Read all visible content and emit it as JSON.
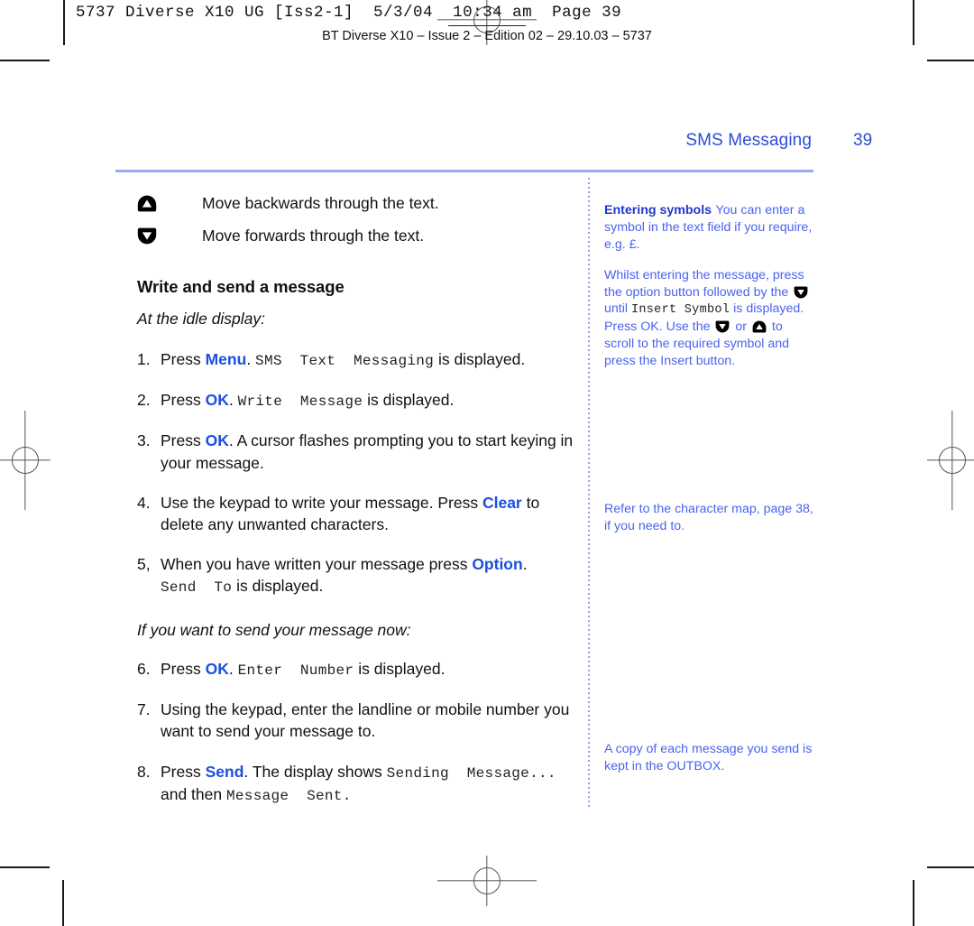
{
  "print_marks": {
    "slug_mono": "5737 Diverse X10 UG [Iss2-1]  5/3/04  10:34 am  Page 39",
    "slug_caption": "BT Diverse X10 – Issue 2 – Edition 02 – 29.10.03 – 5737"
  },
  "running_head": {
    "title": "SMS Messaging",
    "page_number": "39",
    "color": "#2b4cd8"
  },
  "main": {
    "key_rows": [
      {
        "icon": "up-arrow-key-icon",
        "label": "Move backwards through the text."
      },
      {
        "icon": "down-arrow-key-icon",
        "label": "Move forwards through the text."
      }
    ],
    "section_heading": "Write and send a message",
    "intro_italic": "At the idle display:",
    "steps": [
      {
        "num": "1.",
        "parts": [
          {
            "type": "text",
            "value": "Press "
          },
          {
            "type": "key",
            "value": "Menu"
          },
          {
            "type": "text",
            "value": ". "
          },
          {
            "type": "lcd",
            "value": "SMS  Text  Messaging"
          },
          {
            "type": "text",
            "value": " is displayed."
          }
        ]
      },
      {
        "num": "2.",
        "parts": [
          {
            "type": "text",
            "value": "Press "
          },
          {
            "type": "key",
            "value": "OK"
          },
          {
            "type": "text",
            "value": ". "
          },
          {
            "type": "lcd",
            "value": "Write  Message"
          },
          {
            "type": "text",
            "value": " is displayed."
          }
        ]
      },
      {
        "num": "3.",
        "parts": [
          {
            "type": "text",
            "value": "Press "
          },
          {
            "type": "key",
            "value": "OK"
          },
          {
            "type": "text",
            "value": ". A cursor flashes prompting you to start keying in your message."
          }
        ]
      },
      {
        "num": "4.",
        "parts": [
          {
            "type": "text",
            "value": "Use the keypad to write your message. Press "
          },
          {
            "type": "key",
            "value": "Clear"
          },
          {
            "type": "text",
            "value": " to delete any unwanted characters."
          }
        ]
      },
      {
        "num": "5,",
        "parts": [
          {
            "type": "text",
            "value": "When you have written your message press "
          },
          {
            "type": "key",
            "value": "Option"
          },
          {
            "type": "text",
            "value": ". "
          },
          {
            "type": "br",
            "value": ""
          },
          {
            "type": "lcd",
            "value": "Send  To"
          },
          {
            "type": "text",
            "value": " is displayed."
          }
        ]
      }
    ],
    "mid_italic": "If you want to send your message now:",
    "steps2": [
      {
        "num": "6.",
        "parts": [
          {
            "type": "text",
            "value": "Press "
          },
          {
            "type": "key",
            "value": "OK"
          },
          {
            "type": "text",
            "value": ". "
          },
          {
            "type": "lcd",
            "value": "Enter  Number"
          },
          {
            "type": "text",
            "value": " is displayed."
          }
        ]
      },
      {
        "num": "7.",
        "parts": [
          {
            "type": "text",
            "value": "Using the keypad, enter the landline or mobile number you want to send your message to."
          }
        ]
      },
      {
        "num": "8.",
        "parts": [
          {
            "type": "text",
            "value": "Press "
          },
          {
            "type": "key",
            "value": "Send"
          },
          {
            "type": "text",
            "value": ". The display shows "
          },
          {
            "type": "lcd",
            "value": "Sending  Message..."
          },
          {
            "type": "text",
            "value": " and then "
          },
          {
            "type": "lcd",
            "value": "Message  Sent."
          }
        ]
      }
    ]
  },
  "sidebar": {
    "heading": "Entering symbols",
    "para1": "You can enter a symbol in the text field if you require, e.g. £.",
    "para2_a": "Whilst entering the message, press the option button followed by the ",
    "para2_b": " until ",
    "para2_lcd1": "Insert Symbol",
    "para2_c": " is displayed. Press OK. Use the ",
    "para2_d": " or ",
    "para2_e": " to scroll to the required symbol and press the Insert button.",
    "note1": "Refer to the character map, page 38, if you need to.",
    "note2": "A copy of each message you send is kept in the OUTBOX.",
    "heading_color": "#2038c8",
    "body_color": "#4a63ef"
  }
}
